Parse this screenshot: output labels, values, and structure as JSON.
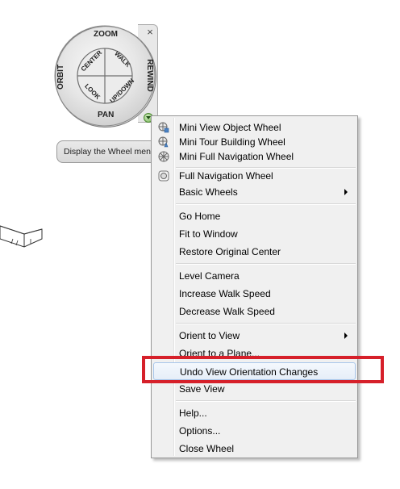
{
  "wheel": {
    "zoom": "ZOOM",
    "orbit": "ORBIT",
    "rewind": "REWIND",
    "pan": "PAN",
    "center": "CENTER",
    "walk": "WALK",
    "look": "LOOK",
    "updown": "UP/DOWN",
    "close_glyph": "×",
    "menu_icon": "menu-arrow-icon"
  },
  "tooltip": {
    "text": "Display the Wheel menu"
  },
  "menu": {
    "items": [
      {
        "label": "Mini View Object Wheel",
        "icon": "mini-view-object-wheel-icon"
      },
      {
        "label": "Mini Tour Building Wheel",
        "icon": "mini-tour-building-wheel-icon"
      },
      {
        "label": "Mini Full Navigation Wheel",
        "icon": "mini-full-navigation-wheel-icon"
      },
      {
        "label": "Full Navigation Wheel",
        "icon": "full-navigation-wheel-icon"
      },
      {
        "label": "Basic Wheels"
      },
      {
        "label": "Go Home"
      },
      {
        "label": "Fit to Window"
      },
      {
        "label": "Restore Original Center"
      },
      {
        "label": "Level Camera"
      },
      {
        "label": "Increase Walk Speed"
      },
      {
        "label": "Decrease Walk Speed"
      },
      {
        "label": "Orient to View"
      },
      {
        "label": "Orient to a Plane..."
      },
      {
        "label": "Undo View Orientation Changes"
      },
      {
        "label": "Save View"
      },
      {
        "label": "Help..."
      },
      {
        "label": "Options..."
      },
      {
        "label": "Close Wheel"
      }
    ]
  },
  "colors": {
    "highlight_box": "#d6202a",
    "menu_bg": "#f0f0f0"
  }
}
